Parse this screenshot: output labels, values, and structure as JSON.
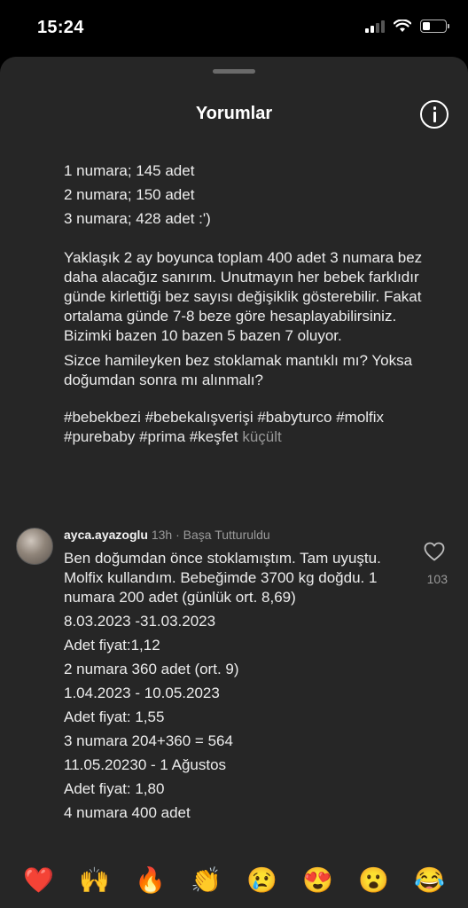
{
  "status_bar": {
    "time": "15:24"
  },
  "header": {
    "title": "Yorumlar"
  },
  "caption": {
    "list_lines": [
      "1 numara; 145 adet",
      "2 numara; 150 adet",
      "3 numara; 428 adet :')"
    ],
    "paragraph1": "Yaklaşık 2 ay boyunca toplam 400 adet 3 numara bez daha alacağız sanırım. Unutmayın her bebek farklıdır günde kirlettiği bez sayısı değişiklik gösterebilir. Fakat ortalama günde 7-8 beze göre hesaplayabilirsiniz. Bizimki bazen 10 bazen 5 bazen 7 oluyor.",
    "paragraph2": "Sizce hamileyken bez stoklamak mantıklı mı? Yoksa doğumdan sonra mı alınmalı?",
    "hashtags": [
      "#bebekbezi",
      "#bebekalışverişi",
      "#babyturco",
      "#molfix",
      "#purebaby",
      "#prima",
      "#keşfet"
    ],
    "collapse_label": "küçült"
  },
  "comment": {
    "username": "ayca.ayazoglu",
    "time": "13h",
    "pinned_label": "Başa Tutturuldu",
    "intro": "Ben doğumdan önce stoklamıştım. Tam uyuştu. Molfix kullandım. Bebeğimde 3700 kg doğdu.  1 numara 200 adet (günlük ort. 8,69)",
    "lines": [
      "8.03.2023 -31.03.2023",
      "Adet fiyat:1,12",
      "2 numara 360 adet (ort. 9)",
      "1.04.2023 - 10.05.2023",
      "Adet fiyat: 1,55",
      "3 numara 204+360 = 564",
      "11.05.20230 - 1 Ağustos",
      "Adet fiyat: 1,80",
      "4 numara 400 adet"
    ],
    "like_count": "103"
  },
  "emoji_bar": [
    "❤️",
    "🙌",
    "🔥",
    "👏",
    "😢",
    "😍",
    "😮",
    "😂"
  ]
}
